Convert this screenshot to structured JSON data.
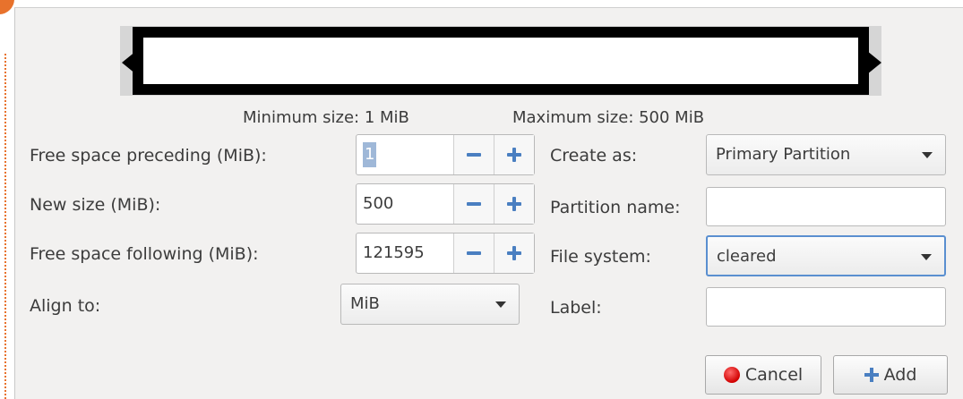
{
  "size_info": {
    "minimum": "Minimum size: 1 MiB",
    "maximum": "Maximum size: 500 MiB"
  },
  "left_form": {
    "free_preceding": {
      "label": "Free space preceding (MiB):",
      "value": "1"
    },
    "new_size": {
      "label": "New size (MiB):",
      "value": "500"
    },
    "free_following": {
      "label": "Free space following (MiB):",
      "value": "121595"
    },
    "align_to": {
      "label": "Align to:",
      "value": "MiB"
    }
  },
  "right_form": {
    "create_as": {
      "label": "Create as:",
      "value": "Primary Partition"
    },
    "partition_name": {
      "label": "Partition name:",
      "value": ""
    },
    "file_system": {
      "label": "File system:",
      "value": "cleared"
    },
    "label": {
      "label": "Label:",
      "value": ""
    }
  },
  "buttons": {
    "cancel": "Cancel",
    "add": "Add"
  },
  "icons": {
    "spin_minus": "minus-icon",
    "spin_plus": "plus-icon",
    "cancel": "stop-red-circle-icon",
    "add": "plus-icon",
    "dropdown": "chevron-down-icon"
  },
  "colors": {
    "accent": "#4a7fc1",
    "focus_border": "#5a8fd0",
    "cancel_red": "#d10000",
    "frame_orange": "#e8722c"
  }
}
